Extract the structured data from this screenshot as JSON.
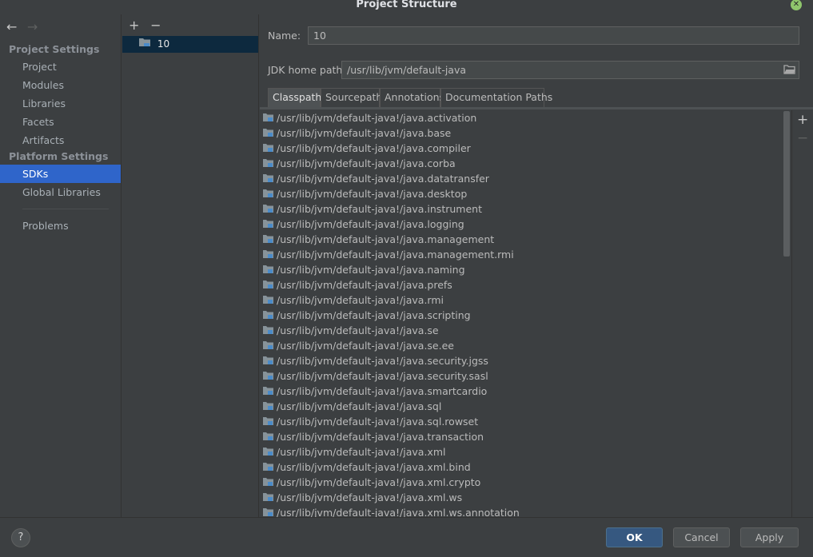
{
  "window": {
    "title": "Project Structure"
  },
  "nav": {
    "back_glyph": "←",
    "forward_glyph": "→",
    "project_settings_title": "Project Settings",
    "project_items": [
      "Project",
      "Modules",
      "Libraries",
      "Facets",
      "Artifacts"
    ],
    "platform_settings_title": "Platform Settings",
    "platform_items": [
      "SDKs",
      "Global Libraries"
    ],
    "selected": "SDKs",
    "problems": "Problems"
  },
  "sdk_list": {
    "add_glyph": "+",
    "remove_glyph": "−",
    "items": [
      "10"
    ]
  },
  "form": {
    "name_label": "Name:",
    "name_value": "10",
    "jdk_label": "JDK home path:",
    "jdk_value": "/usr/lib/jvm/default-java"
  },
  "tabs": [
    "Classpath",
    "Sourcepath",
    "Annotations",
    "Documentation Paths"
  ],
  "active_tab": "Classpath",
  "classpath": [
    "/usr/lib/jvm/default-java!/java.activation",
    "/usr/lib/jvm/default-java!/java.base",
    "/usr/lib/jvm/default-java!/java.compiler",
    "/usr/lib/jvm/default-java!/java.corba",
    "/usr/lib/jvm/default-java!/java.datatransfer",
    "/usr/lib/jvm/default-java!/java.desktop",
    "/usr/lib/jvm/default-java!/java.instrument",
    "/usr/lib/jvm/default-java!/java.logging",
    "/usr/lib/jvm/default-java!/java.management",
    "/usr/lib/jvm/default-java!/java.management.rmi",
    "/usr/lib/jvm/default-java!/java.naming",
    "/usr/lib/jvm/default-java!/java.prefs",
    "/usr/lib/jvm/default-java!/java.rmi",
    "/usr/lib/jvm/default-java!/java.scripting",
    "/usr/lib/jvm/default-java!/java.se",
    "/usr/lib/jvm/default-java!/java.se.ee",
    "/usr/lib/jvm/default-java!/java.security.jgss",
    "/usr/lib/jvm/default-java!/java.security.sasl",
    "/usr/lib/jvm/default-java!/java.smartcardio",
    "/usr/lib/jvm/default-java!/java.sql",
    "/usr/lib/jvm/default-java!/java.sql.rowset",
    "/usr/lib/jvm/default-java!/java.transaction",
    "/usr/lib/jvm/default-java!/java.xml",
    "/usr/lib/jvm/default-java!/java.xml.bind",
    "/usr/lib/jvm/default-java!/java.xml.crypto",
    "/usr/lib/jvm/default-java!/java.xml.ws",
    "/usr/lib/jvm/default-java!/java.xml.ws.annotation"
  ],
  "side_tools": {
    "add_glyph": "+",
    "remove_glyph": "−"
  },
  "footer": {
    "help_glyph": "?",
    "ok": "OK",
    "cancel": "Cancel",
    "apply": "Apply"
  },
  "colors": {
    "background": "#3c3f41",
    "selection": "#2f65ca",
    "primary_button": "#365880",
    "close": "#8fc66c"
  }
}
